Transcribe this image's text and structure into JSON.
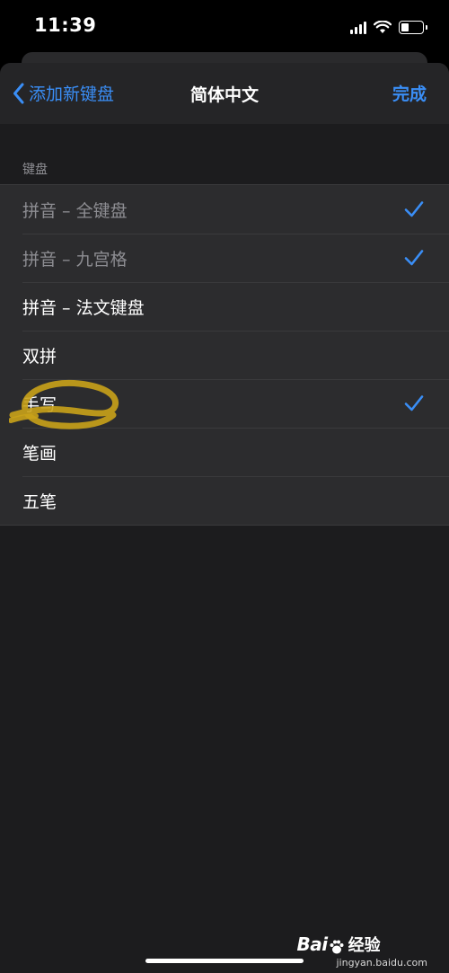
{
  "status_bar": {
    "time": "11:39"
  },
  "nav": {
    "back_label": "添加新键盘",
    "title": "简体中文",
    "done_label": "完成"
  },
  "section_header": "键盘",
  "keyboards": [
    {
      "label": "拼音 – 全键盘",
      "checked": true,
      "disabled": true
    },
    {
      "label": "拼音 – 九宫格",
      "checked": true,
      "disabled": true
    },
    {
      "label": "拼音 – 法文键盘",
      "checked": false,
      "disabled": false
    },
    {
      "label": "双拼",
      "checked": false,
      "disabled": false
    },
    {
      "label": "手写",
      "checked": true,
      "disabled": false
    },
    {
      "label": "笔画",
      "checked": false,
      "disabled": false
    },
    {
      "label": "五笔",
      "checked": false,
      "disabled": false
    }
  ],
  "watermark": {
    "logo_a": "Bai",
    "logo_b": "经验",
    "url": "jingyan.baidu.com"
  },
  "colors": {
    "accent": "#3a8ef6",
    "background": "#1c1c1e",
    "cell": "#2c2c2e",
    "highlight": "#c9a21a"
  }
}
